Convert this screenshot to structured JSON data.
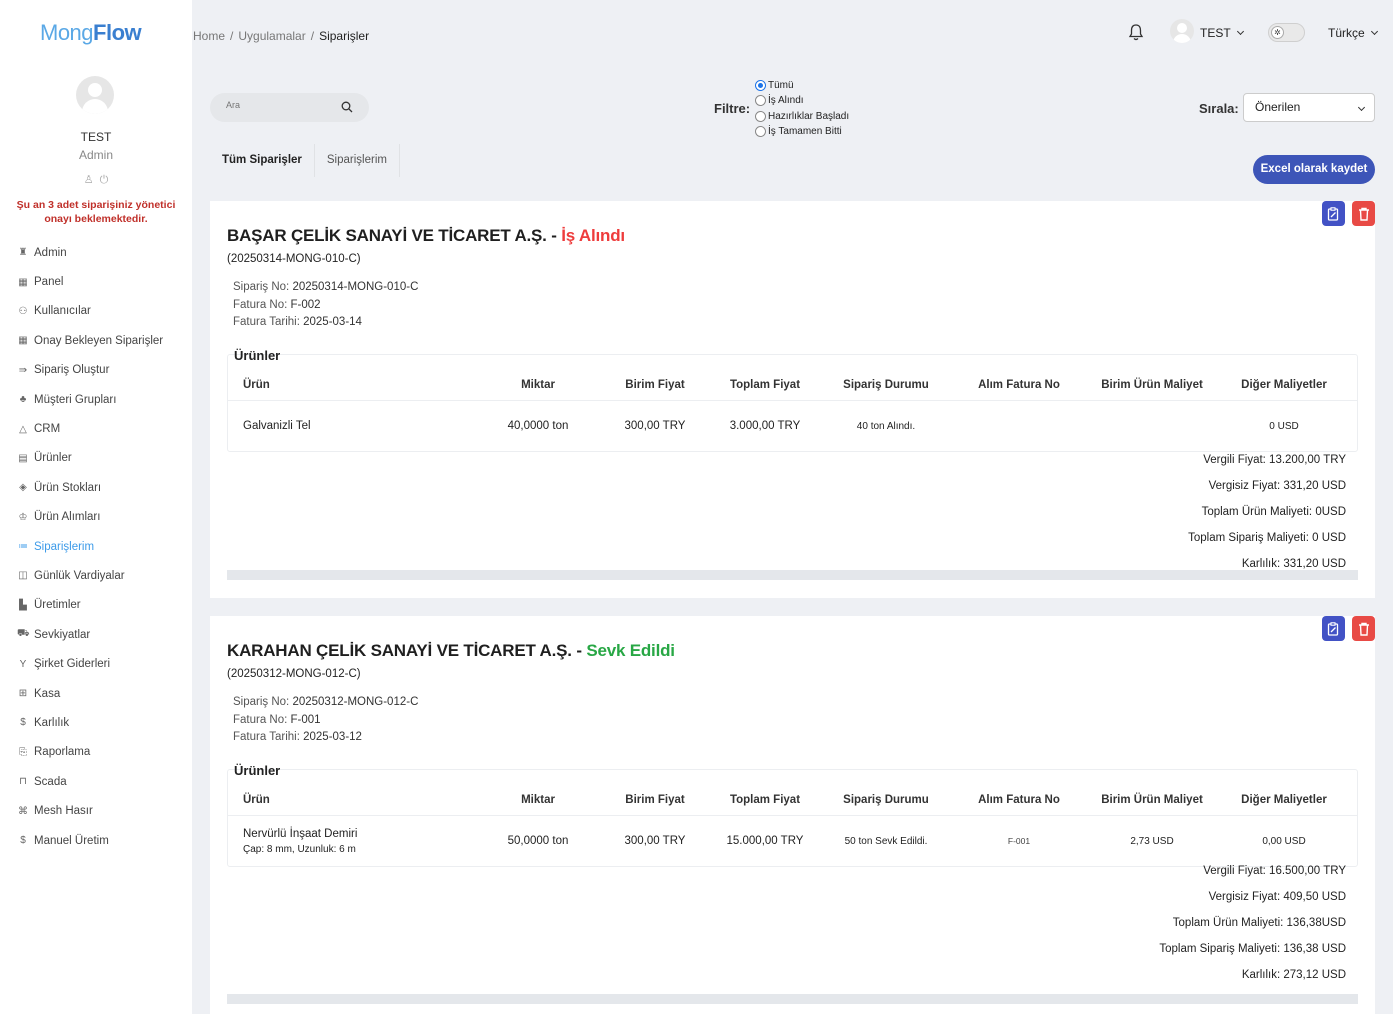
{
  "app": {
    "logo_part1": "Mong",
    "logo_part2": "Flow"
  },
  "user": {
    "name": "TEST",
    "role": "Admin",
    "pending_note": "Şu an 3 adet siparişiniz yönetici onayı beklemektedir."
  },
  "sidebar": {
    "items": [
      {
        "label": "Admin",
        "icon": "admin-icon",
        "glyph": "♜"
      },
      {
        "label": "Panel",
        "icon": "panel-icon",
        "glyph": "▦"
      },
      {
        "label": "Kullanıcılar",
        "icon": "users-icon",
        "glyph": "⚇"
      },
      {
        "label": "Onay Bekleyen Siparişler",
        "icon": "pending-orders-icon",
        "glyph": "▦"
      },
      {
        "label": "Sipariş Oluştur",
        "icon": "create-order-icon",
        "glyph": "⇛"
      },
      {
        "label": "Müşteri Grupları",
        "icon": "customer-groups-icon",
        "glyph": "♣"
      },
      {
        "label": "CRM",
        "icon": "crm-icon",
        "glyph": "△"
      },
      {
        "label": "Ürünler",
        "icon": "products-icon",
        "glyph": "▤"
      },
      {
        "label": "Ürün Stokları",
        "icon": "stock-icon",
        "glyph": "◈"
      },
      {
        "label": "Ürün Alımları",
        "icon": "purchases-icon",
        "glyph": "♔"
      },
      {
        "label": "Siparişlerim",
        "icon": "my-orders-icon",
        "glyph": "≔",
        "active": true
      },
      {
        "label": "Günlük Vardiyalar",
        "icon": "shifts-icon",
        "glyph": "◫"
      },
      {
        "label": "Üretimler",
        "icon": "productions-icon",
        "glyph": "▙"
      },
      {
        "label": "Sevkiyatlar",
        "icon": "shipments-icon",
        "glyph": "⛟"
      },
      {
        "label": "Şirket Giderleri",
        "icon": "expenses-icon",
        "glyph": "Y"
      },
      {
        "label": "Kasa",
        "icon": "cash-icon",
        "glyph": "⊞"
      },
      {
        "label": "Karlılık",
        "icon": "profit-icon",
        "glyph": "$"
      },
      {
        "label": "Raporlama",
        "icon": "report-icon",
        "glyph": "⎘"
      },
      {
        "label": "Scada",
        "icon": "scada-icon",
        "glyph": "⊓"
      },
      {
        "label": "Mesh Hasır",
        "icon": "mesh-icon",
        "glyph": "⌘"
      },
      {
        "label": "Manuel Üretim",
        "icon": "manual-production-icon",
        "glyph": "$"
      }
    ]
  },
  "breadcrumb": {
    "home": "Home",
    "apps": "Uygulamalar",
    "current": "Siparişler"
  },
  "topbar": {
    "user": "TEST",
    "language": "Türkçe"
  },
  "search": {
    "placeholder": "Ara"
  },
  "filter": {
    "label": "Filtre:",
    "options": [
      "Tümü",
      "İş Alındı",
      "Hazırlıklar Başladı",
      "İş Tamamen Bitti"
    ],
    "selected": "Tümü"
  },
  "sort": {
    "label": "Sırala:",
    "selected": "Önerilen"
  },
  "tabs": [
    "Tüm Siparişler",
    "Siparişlerim"
  ],
  "excel_button": "Excel olarak kaydet",
  "table_headers": [
    "Ürün",
    "Miktar",
    "Birim Fiyat",
    "Toplam Fiyat",
    "Sipariş Durumu",
    "Alım Fatura No",
    "Birim Ürün Maliyet",
    "Diğer Maliyetler"
  ],
  "orders": [
    {
      "company": "BAŞAR ÇELİK SANAYİ VE TİCARET A.Ş. - ",
      "status": "İş Alındı",
      "status_color": "#ee3c3c",
      "code": "(20250314-MONG-010-C)",
      "order_no_label": "Sipariş No:",
      "order_no": "20250314-MONG-010-C",
      "invoice_no_label": "Fatura No:",
      "invoice_no": "F-002",
      "invoice_date_label": "Fatura Tarihi:",
      "invoice_date": "2025-03-14",
      "products_label": "Ürünler",
      "products": [
        {
          "name": "Galvanizli Tel",
          "desc": "",
          "qty": "40,0000 ton",
          "unit_price": "300,00 TRY",
          "total": "3.000,00 TRY",
          "status": "40 ton Alındı.",
          "purchase_invoice": "",
          "unit_cost": "",
          "other_costs": "0 USD"
        }
      ],
      "totals": {
        "taxed": "Vergili Fiyat: 13.200,00 TRY",
        "untaxed": "Vergisiz Fiyat: 331,20 USD",
        "product_cost": "Toplam Ürün Maliyeti: 0USD",
        "order_cost": "Toplam Sipariş Maliyeti: 0 USD",
        "profit": "Karlılık: 331,20 USD"
      }
    },
    {
      "company": "KARAHAN ÇELİK SANAYİ VE TİCARET A.Ş. - ",
      "status": "Sevk Edildi",
      "status_color": "#28a745",
      "code": "(20250312-MONG-012-C)",
      "order_no_label": "Sipariş No:",
      "order_no": "20250312-MONG-012-C",
      "invoice_no_label": "Fatura No:",
      "invoice_no": "F-001",
      "invoice_date_label": "Fatura Tarihi:",
      "invoice_date": "2025-03-12",
      "products_label": "Ürünler",
      "products": [
        {
          "name": "Nervürlü İnşaat Demiri",
          "desc": "Çap: 8 mm, Uzunluk: 6 m",
          "qty": "50,0000 ton",
          "unit_price": "300,00 TRY",
          "total": "15.000,00 TRY",
          "status": "50 ton Sevk Edildi.",
          "purchase_invoice": "F-001",
          "unit_cost": "2,73 USD",
          "other_costs": "0,00 USD"
        }
      ],
      "totals": {
        "taxed": "Vergili Fiyat: 16.500,00 TRY",
        "untaxed": "Vergisiz Fiyat: 409,50 USD",
        "product_cost": "Toplam Ürün Maliyeti: 136,38USD",
        "order_cost": "Toplam Sipariş Maliyeti: 136,38 USD",
        "profit": "Karlılık: 273,12 USD"
      }
    }
  ],
  "colors": {
    "accent": "#3d55b8",
    "active_menu": "#3d9be9",
    "danger": "#e84a45",
    "edit": "#4252c5"
  }
}
